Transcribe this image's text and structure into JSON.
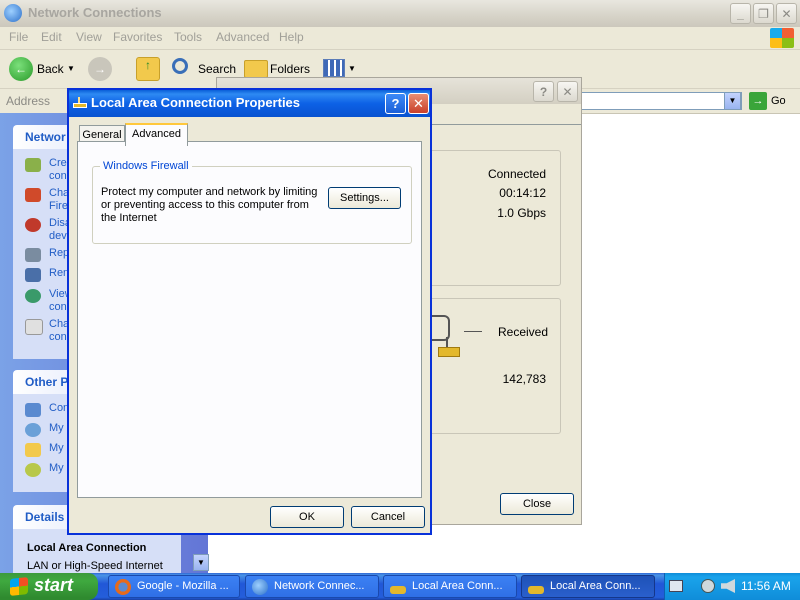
{
  "explorer": {
    "title": "Network Connections",
    "menu": [
      "File",
      "Edit",
      "View",
      "Favorites",
      "Tools",
      "Advanced",
      "Help"
    ],
    "toolbar": {
      "back": "Back",
      "search": "Search",
      "folders": "Folders"
    },
    "address_label": "Address",
    "go_label": "Go",
    "sidebar": {
      "network_tasks_title": "Networ",
      "network_tasks": [
        "Crea",
        "con",
        "Cha",
        "Fire",
        "Disa",
        "dev",
        "Rep",
        "Ren",
        "View",
        "con",
        "Cha",
        "con"
      ],
      "other_places_title": "Other P",
      "other_places": [
        "Con",
        "My",
        "My",
        "My"
      ],
      "details_title": "Details",
      "details_name": "Local Area Connection",
      "details_sub": "LAN or High-Speed Internet"
    }
  },
  "status_dialog": {
    "status": "Connected",
    "duration": "00:14:12",
    "speed": "1.0 Gbps",
    "received_label": "Received",
    "received_value": "142,783",
    "close_label": "Close",
    "help_btn": "?",
    "close_btn": "✕"
  },
  "props_dialog": {
    "title": "Local Area Connection Properties",
    "tabs": [
      "General",
      "Advanced"
    ],
    "active_tab": "Advanced",
    "firewall_group": "Windows Firewall",
    "firewall_text": "Protect my computer and network by limiting or preventing access to this computer from the Internet",
    "settings_label": "Settings...",
    "ok_label": "OK",
    "cancel_label": "Cancel",
    "help_btn": "?",
    "close_btn": "✕"
  },
  "taskbar": {
    "start_label": "start",
    "buttons": [
      "Google - Mozilla ...",
      "Network Connec...",
      "Local Area Conn...",
      "Local Area Conn..."
    ],
    "clock": "11:56 AM"
  }
}
